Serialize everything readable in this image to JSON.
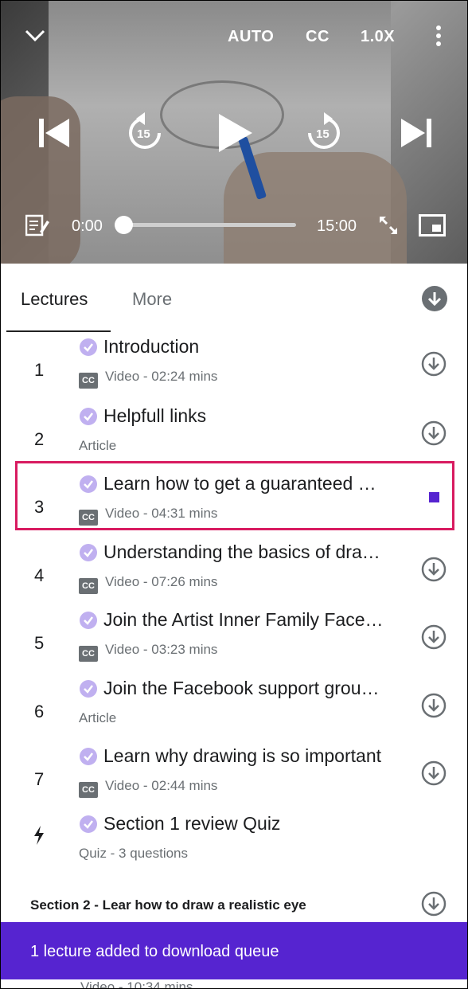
{
  "player": {
    "quality": "AUTO",
    "captions": "CC",
    "speed": "1.0X",
    "skip_back_seconds": "15",
    "skip_forward_seconds": "15",
    "current_time": "0:00",
    "duration": "15:00",
    "progress": 0.0
  },
  "tabs": [
    {
      "label": "Lectures",
      "active": true
    },
    {
      "label": "More",
      "active": false
    }
  ],
  "lectures": [
    {
      "num": "1",
      "title": "Introduction",
      "meta": "Video - 02:24 mins",
      "captions": true
    },
    {
      "num": "2",
      "title": "Helpfull links",
      "meta": "Article",
      "captions": false
    },
    {
      "num": "3",
      "title": "Learn how to get a guaranteed …",
      "meta": "Video - 04:31 mins",
      "captions": true,
      "queued": true
    },
    {
      "num": "4",
      "title": "Understanding the basics of dra…",
      "meta": "Video - 07:26 mins",
      "captions": true
    },
    {
      "num": "5",
      "title": "Join the Artist Inner Family Face…",
      "meta": "Video - 03:23 mins",
      "captions": true
    },
    {
      "num": "6",
      "title": "Join the Facebook support grou…",
      "meta": "Article",
      "captions": false
    },
    {
      "num": "7",
      "title": "Learn why drawing is so important",
      "meta": "Video - 02:44 mins",
      "captions": true
    },
    {
      "num": "",
      "title": "Section 1 review Quiz",
      "meta": "Quiz - 3 questions",
      "captions": false,
      "quiz": true
    }
  ],
  "cc_badge": "CC",
  "section2": {
    "title": "Section 2 - Lear how to draw a realistic eye"
  },
  "snackbar": {
    "message": "1 lecture added to download queue"
  },
  "peek_row": {
    "meta": "Video - 10:34 mins"
  },
  "colors": {
    "accent": "#5624d0",
    "check": "#c0b0f0",
    "highlight": "#d81b60",
    "muted": "#6a6f73"
  }
}
